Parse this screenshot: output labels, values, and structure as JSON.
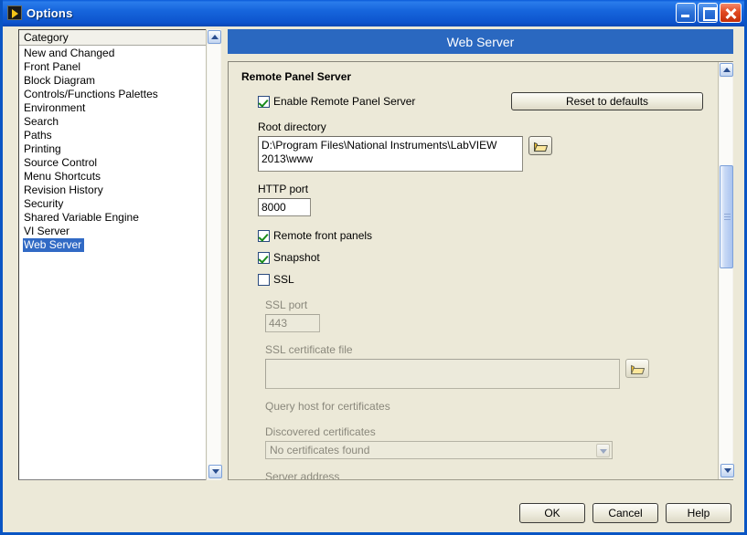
{
  "window": {
    "title": "Options",
    "app_icon": "labview-icon",
    "minimize_label": "Minimize",
    "maximize_label": "Maximize",
    "close_label": "Close"
  },
  "sidebar": {
    "header": "Category",
    "items": [
      {
        "label": "New and Changed",
        "selected": false
      },
      {
        "label": "Front Panel",
        "selected": false
      },
      {
        "label": "Block Diagram",
        "selected": false
      },
      {
        "label": "Controls/Functions Palettes",
        "selected": false
      },
      {
        "label": "Environment",
        "selected": false
      },
      {
        "label": "Search",
        "selected": false
      },
      {
        "label": "Paths",
        "selected": false
      },
      {
        "label": "Printing",
        "selected": false
      },
      {
        "label": "Source Control",
        "selected": false
      },
      {
        "label": "Menu Shortcuts",
        "selected": false
      },
      {
        "label": "Revision History",
        "selected": false
      },
      {
        "label": "Security",
        "selected": false
      },
      {
        "label": "Shared Variable Engine",
        "selected": false
      },
      {
        "label": "VI Server",
        "selected": false
      },
      {
        "label": "Web Server",
        "selected": true
      }
    ],
    "selection_color": "#316ac5"
  },
  "main": {
    "header_title": "Web Server",
    "header_color": "#2a68c0",
    "group_title": "Remote Panel Server",
    "enable_checkbox": {
      "label": "Enable Remote Panel Server",
      "checked": true
    },
    "reset_button": "Reset to defaults",
    "root_directory": {
      "label": "Root directory",
      "value": "D:\\Program Files\\National Instruments\\LabVIEW 2013\\www",
      "browse_icon": "folder-open-icon"
    },
    "http_port": {
      "label": "HTTP port",
      "value": "8000"
    },
    "remote_front_panels": {
      "label": "Remote front panels",
      "checked": true
    },
    "snapshot": {
      "label": "Snapshot",
      "checked": true
    },
    "ssl": {
      "label": "SSL",
      "checked": false
    },
    "ssl_port": {
      "label": "SSL port",
      "value": "443",
      "disabled": true
    },
    "ssl_certificate_file": {
      "label": "SSL certificate file",
      "value": "",
      "disabled": true,
      "browse_icon": "folder-open-icon"
    },
    "query_host": {
      "label": "Query host for certificates",
      "disabled": true
    },
    "discovered_certificates": {
      "label": "Discovered certificates",
      "selected_option": "No certificates found",
      "disabled": true
    },
    "server_address": {
      "label": "Server address",
      "disabled": true
    }
  },
  "footer": {
    "ok": "OK",
    "cancel": "Cancel",
    "help": "Help"
  }
}
